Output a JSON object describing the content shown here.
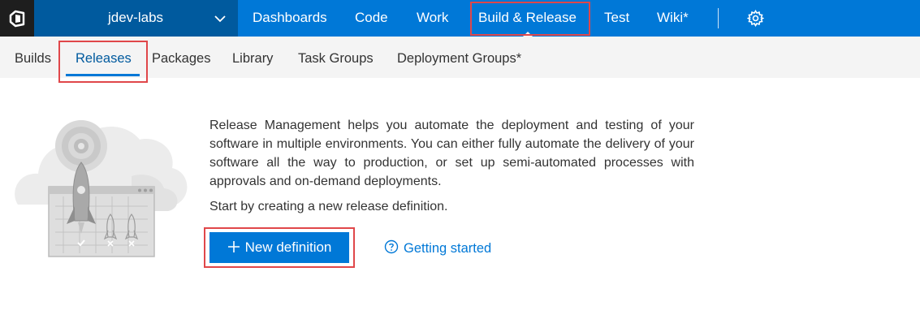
{
  "header": {
    "project_name": "jdev-labs",
    "nav": {
      "dashboards": "Dashboards",
      "code": "Code",
      "work": "Work",
      "build_release": "Build & Release",
      "test": "Test",
      "wiki": "Wiki*"
    }
  },
  "subnav": {
    "builds": "Builds",
    "releases": "Releases",
    "packages": "Packages",
    "library": "Library",
    "task_groups": "Task Groups",
    "deployment_groups": "Deployment Groups*"
  },
  "main": {
    "description": "Release Management helps you automate the deployment and testing of your software in multiple environments. You can either fully automate the delivery of your software all the way to production, or set up semi-automated processes with approvals and on-demand deployments.",
    "start_text": "Start by creating a new release definition.",
    "new_definition_label": "New definition",
    "getting_started_label": "Getting started"
  },
  "colors": {
    "accent": "#0078d7",
    "project_bg": "#005a9e",
    "highlight_box": "#e0474a"
  },
  "icons": [
    "vsts-logo-icon",
    "chevron-down-icon",
    "gear-icon",
    "plus-icon",
    "help-circle-icon",
    "release-rocket-illustration"
  ]
}
